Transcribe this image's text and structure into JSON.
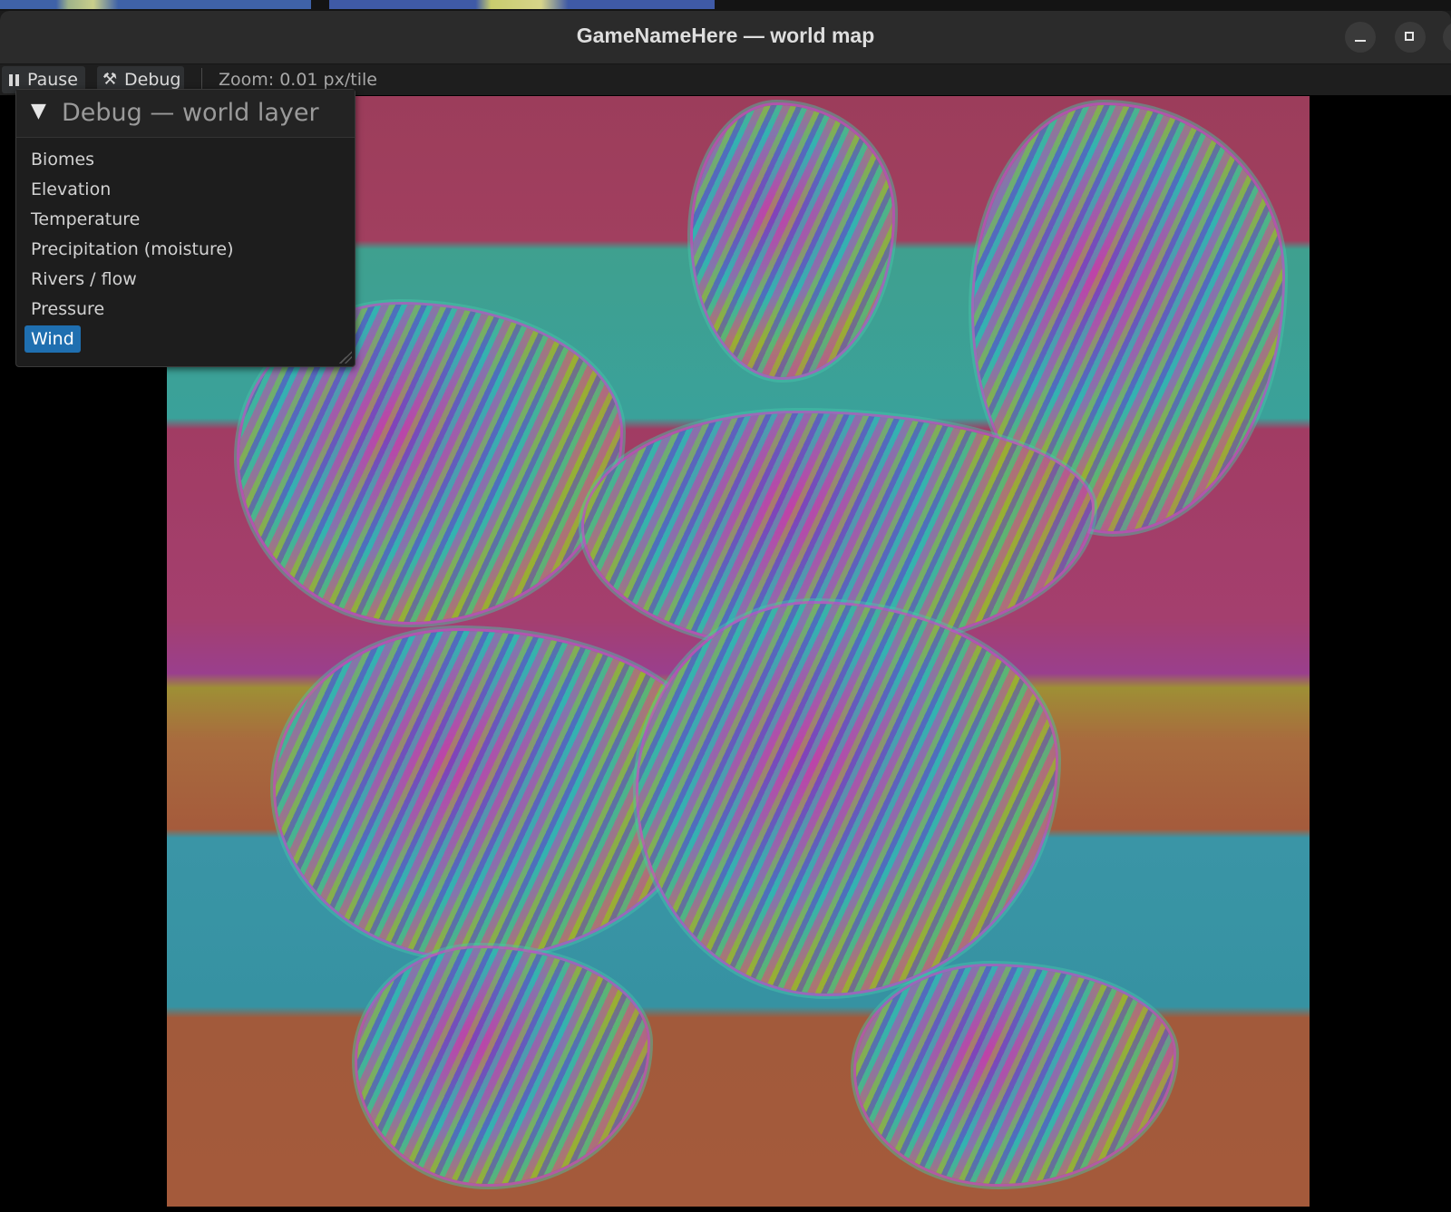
{
  "window": {
    "title": "GameNameHere — world map"
  },
  "toolbar": {
    "pause_label": "Pause",
    "debug_label": "Debug",
    "zoom_text": "Zoom: 0.01 px/tile"
  },
  "debug_panel": {
    "title": "Debug — world layer",
    "expanded": true,
    "items": [
      {
        "label": "Biomes",
        "selected": false
      },
      {
        "label": "Elevation",
        "selected": false
      },
      {
        "label": "Temperature",
        "selected": false
      },
      {
        "label": "Precipitation (moisture)",
        "selected": false
      },
      {
        "label": "Rivers / flow",
        "selected": false
      },
      {
        "label": "Pressure",
        "selected": false
      },
      {
        "label": "Wind",
        "selected": true
      }
    ]
  },
  "map": {
    "active_layer": "Wind"
  },
  "colors": {
    "selection": "#1f6fb0",
    "band_magenta": "#a13f5f",
    "band_teal": "#3aa19a",
    "band_orange": "#a55b3c",
    "band_cyan": "#3692a2"
  },
  "icons": [
    "pause-icon",
    "wrench-icon",
    "collapse-triangle-icon",
    "minimize-icon",
    "maximize-icon",
    "close-icon",
    "resize-grip-icon"
  ]
}
